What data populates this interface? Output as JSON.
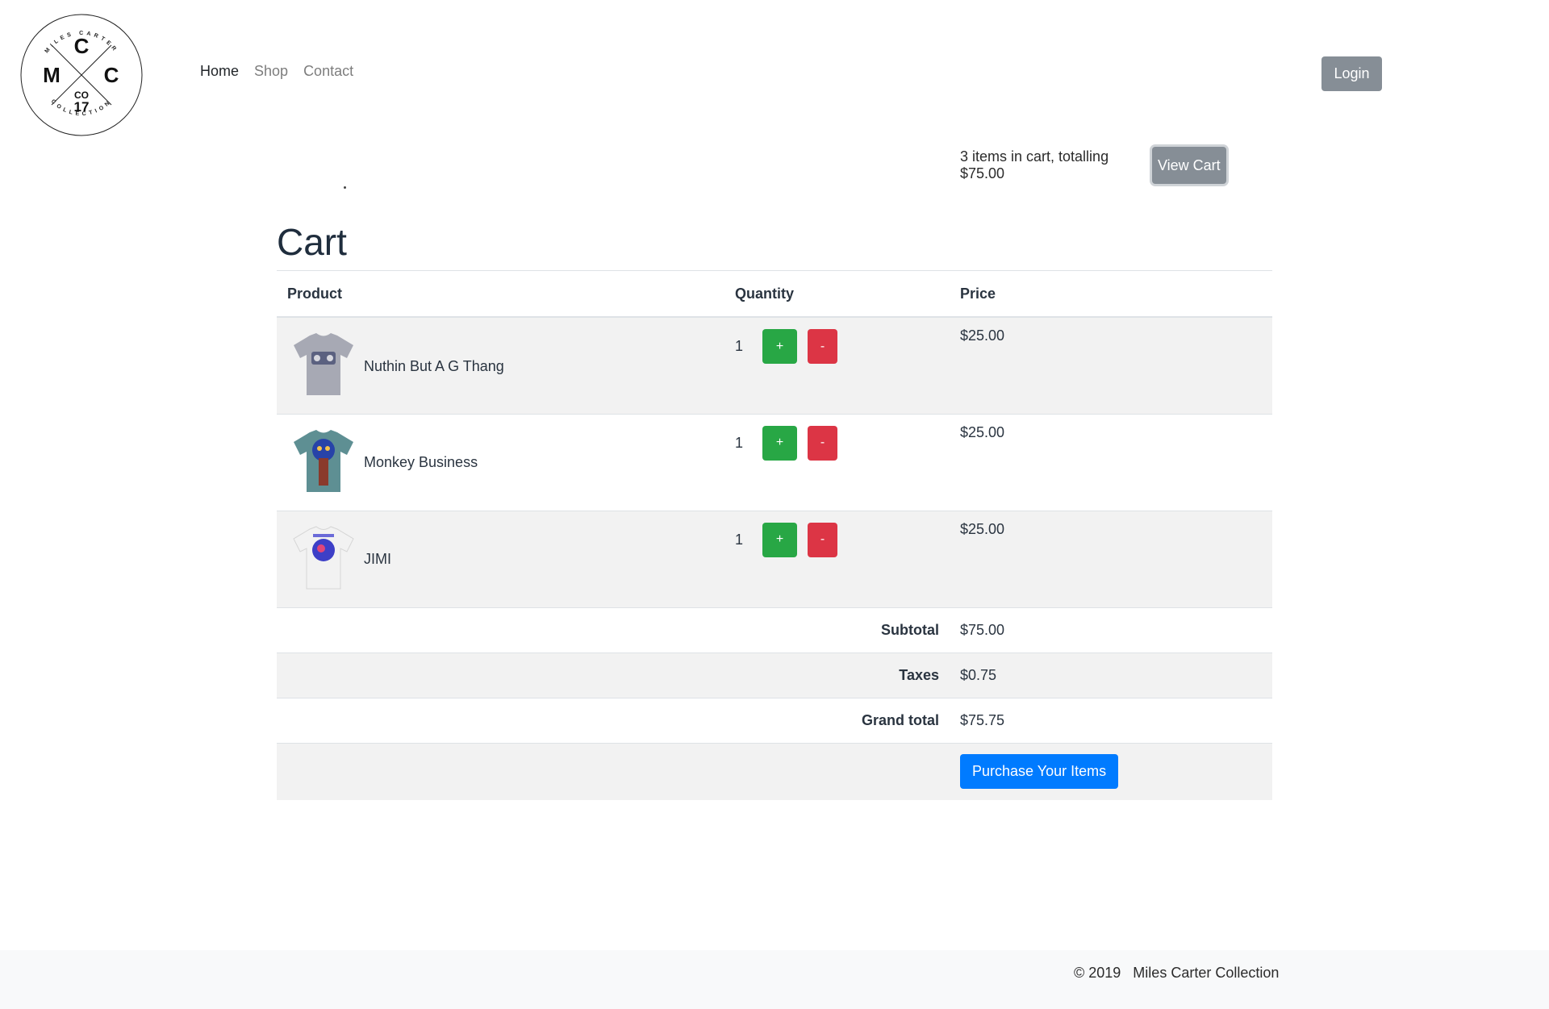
{
  "brand": {
    "logo_top_text": "MILES CARTER",
    "logo_bottom_text": "COLLECTION",
    "logo_letters": [
      "C",
      "M",
      "C"
    ],
    "logo_co": "CO",
    "logo_year": "17"
  },
  "nav": {
    "items": [
      {
        "label": "Home",
        "active": true
      },
      {
        "label": "Shop",
        "active": false
      },
      {
        "label": "Contact",
        "active": false
      }
    ]
  },
  "header": {
    "login_label": "Login",
    "cart_summary": "3 items in cart, totalling $75.00",
    "view_cart_label": "View Cart"
  },
  "cart": {
    "title": "Cart",
    "columns": [
      "Product",
      "Quantity",
      "Price"
    ],
    "items": [
      {
        "name": "Nuthin But A G Thang",
        "quantity": "1",
        "price": "$25.00",
        "shirt_color": "#a7a9b4",
        "print_color": "#5b6180"
      },
      {
        "name": "Monkey Business",
        "quantity": "1",
        "price": "$25.00",
        "shirt_color": "#5e8f93",
        "print_color": "#2743a8"
      },
      {
        "name": "JIMI",
        "quantity": "1",
        "price": "$25.00",
        "shirt_color": "#f2f2f2",
        "print_color": "#3d3fc7"
      }
    ],
    "plus_label": "+",
    "minus_label": "-",
    "subtotal_label": "Subtotal",
    "subtotal": "$75.00",
    "taxes_label": "Taxes",
    "taxes": "$0.75",
    "grand_total_label": "Grand total",
    "grand_total": "$75.75",
    "purchase_label": "Purchase Your Items"
  },
  "footer": {
    "text": "© 2019   Miles Carter Collection"
  },
  "colors": {
    "success": "#28a745",
    "danger": "#dc3545",
    "primary": "#007bff",
    "secondary": "#868e96"
  }
}
